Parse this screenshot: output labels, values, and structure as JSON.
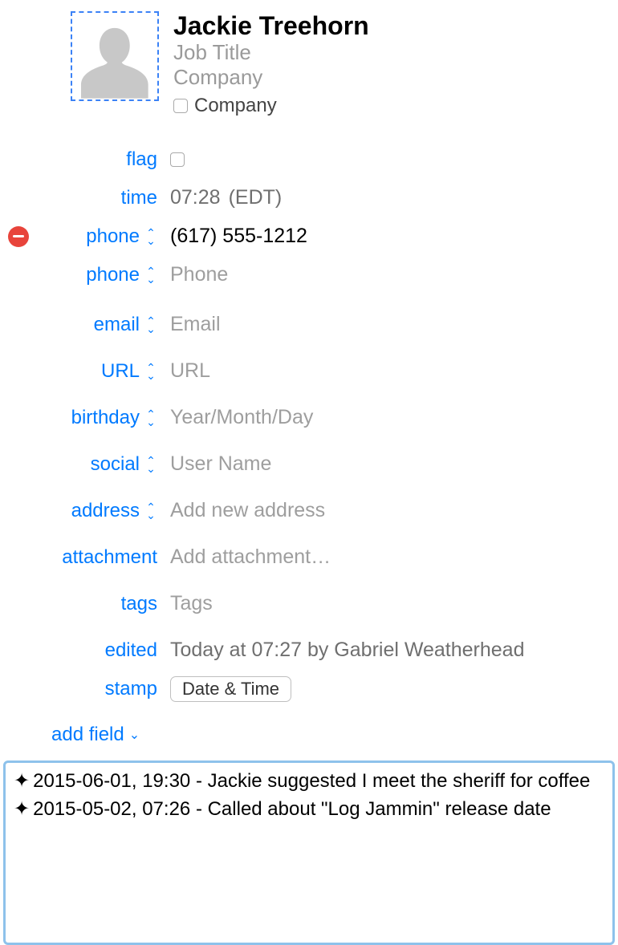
{
  "contact": {
    "name": "Jackie Treehorn",
    "job_title_placeholder": "Job Title",
    "company_placeholder": "Company",
    "company_checkbox_label": "Company"
  },
  "fields": {
    "flag": {
      "label": "flag"
    },
    "time": {
      "label": "time",
      "value": "07:28",
      "tz": "(EDT)"
    },
    "phone1": {
      "label": "phone",
      "value": "(617) 555-1212"
    },
    "phone2": {
      "label": "phone",
      "placeholder": "Phone"
    },
    "email": {
      "label": "email",
      "placeholder": "Email"
    },
    "url": {
      "label": "URL",
      "placeholder": "URL"
    },
    "birthday": {
      "label": "birthday",
      "placeholder": "Year/Month/Day"
    },
    "social": {
      "label": "social",
      "placeholder": "User Name"
    },
    "address": {
      "label": "address",
      "placeholder": "Add new address"
    },
    "attachment": {
      "label": "attachment",
      "placeholder": "Add attachment…"
    },
    "tags": {
      "label": "tags",
      "placeholder": "Tags"
    },
    "edited": {
      "label": "edited",
      "value": "Today at 07:27  by Gabriel Weatherhead"
    },
    "stamp": {
      "label": "stamp",
      "button": "Date & Time"
    }
  },
  "add_field_label": "add field",
  "notes": [
    "2015-06-01, 19:30  - Jackie suggested I meet the sheriff for coffee",
    "2015-05-02, 07:26  - Called about \"Log Jammin\" release date"
  ]
}
